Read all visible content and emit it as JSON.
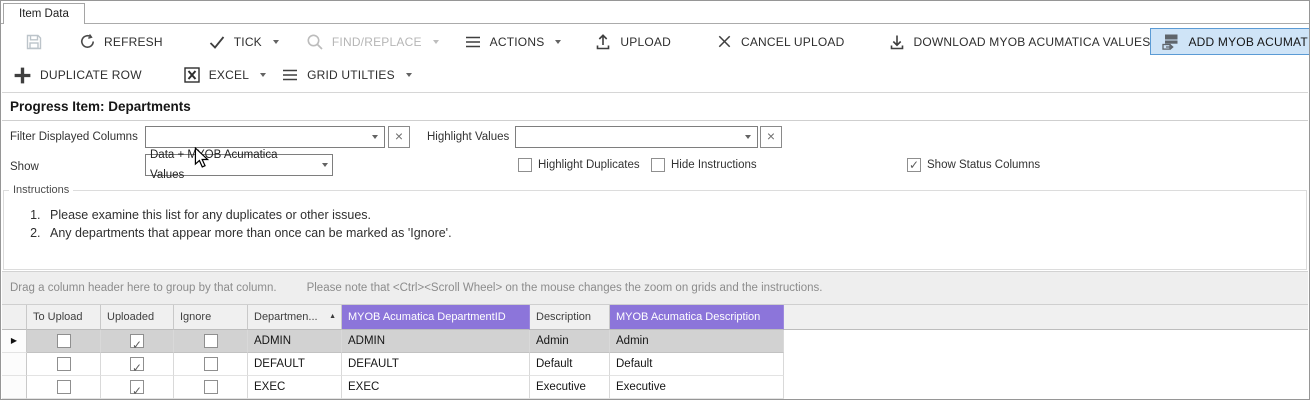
{
  "window": {
    "tab": "Item Data"
  },
  "toolbar": {
    "main": [
      {
        "name": "save",
        "label": "",
        "disabled": true
      },
      {
        "name": "refresh",
        "label": "REFRESH"
      },
      {
        "name": "tick",
        "label": "TICK",
        "dropdown": true
      },
      {
        "name": "find-replace",
        "label": "FIND/REPLACE",
        "dropdown": true,
        "disabled": true
      },
      {
        "name": "actions",
        "label": "ACTIONS",
        "dropdown": true
      },
      {
        "name": "upload",
        "label": "UPLOAD"
      },
      {
        "name": "cancel-upload",
        "label": "CANCEL UPLOAD"
      },
      {
        "name": "download-values",
        "label": "DOWNLOAD MYOB ACUMATICA VALUES"
      },
      {
        "name": "add-rows",
        "label": "ADD MYOB ACUMATICA ROWS",
        "active": true
      }
    ],
    "secondary": [
      {
        "name": "duplicate-row",
        "label": "DUPLICATE ROW"
      },
      {
        "name": "excel",
        "label": "EXCEL",
        "dropdown": true
      },
      {
        "name": "grid-utilities",
        "label": "GRID UTILTIES",
        "dropdown": true
      }
    ]
  },
  "heading": "Progress Item: Departments",
  "filters": {
    "filter_displayed_columns": {
      "label": "Filter Displayed Columns",
      "value": ""
    },
    "highlight_values": {
      "label": "Highlight Values",
      "value": ""
    },
    "show": {
      "label": "Show",
      "value": "Data + MYOB Acumatica Values"
    },
    "highlight_duplicates": {
      "label": "Highlight Duplicates",
      "checked": false
    },
    "hide_instructions": {
      "label": "Hide Instructions",
      "checked": false
    },
    "show_status_columns": {
      "label": "Show Status Columns",
      "checked": true
    }
  },
  "instructions": {
    "legend": "Instructions",
    "items": [
      "Please examine this list for any duplicates or other issues.",
      "Any departments that appear more than once can be marked as 'Ignore'."
    ]
  },
  "grid": {
    "group_hint": "Drag a column header here to group by that column.",
    "zoom_note": "Please note that <Ctrl><Scroll Wheel> on the mouse changes the zoom on grids and the instructions.",
    "columns": [
      {
        "label": "To Upload"
      },
      {
        "label": "Uploaded"
      },
      {
        "label": "Ignore"
      },
      {
        "label": "Departmen...",
        "sort": "asc"
      },
      {
        "label": "MYOB Acumatica DepartmentID",
        "purple": true
      },
      {
        "label": "Description"
      },
      {
        "label": "MYOB Acumatica Description",
        "purple": true
      }
    ],
    "rows": [
      {
        "to_upload": false,
        "uploaded": true,
        "ignore": false,
        "department": "ADMIN",
        "myob_department_id": "ADMIN",
        "description": "Admin",
        "myob_description": "Admin",
        "selected": true
      },
      {
        "to_upload": false,
        "uploaded": true,
        "ignore": false,
        "department": "DEFAULT",
        "myob_department_id": "DEFAULT",
        "description": "Default",
        "myob_description": "Default",
        "selected": false
      },
      {
        "to_upload": false,
        "uploaded": true,
        "ignore": false,
        "department": "EXEC",
        "myob_department_id": "EXEC",
        "description": "Executive",
        "myob_description": "Executive",
        "selected": false
      }
    ]
  },
  "colors": {
    "header_purple": "#8c75da",
    "active_button_bg": "#cfe4f7",
    "active_button_border": "#5b9bd5",
    "selected_row": "#d2d2d2"
  }
}
